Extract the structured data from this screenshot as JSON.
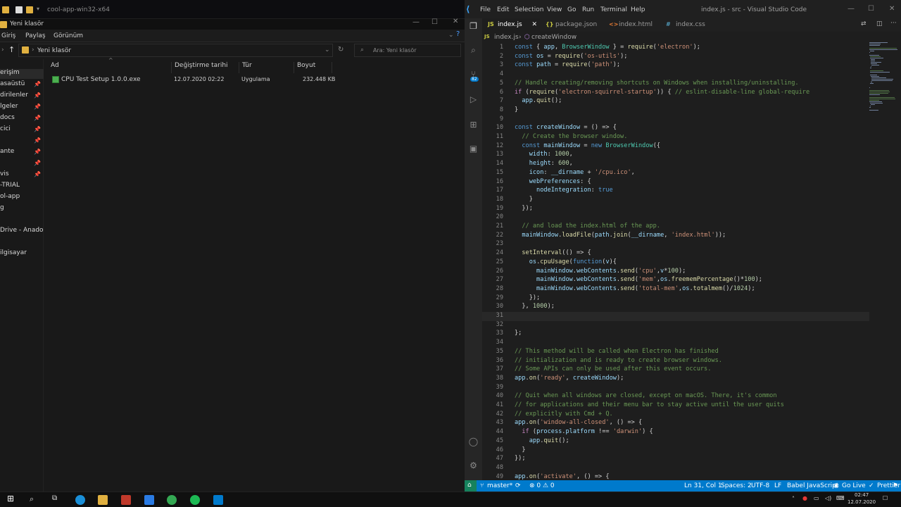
{
  "explorer": {
    "window_title": "cool-app-win32-x64",
    "folder_title": "Yeni klasör",
    "ribbon": [
      "Giriş",
      "Paylaş",
      "Görünüm"
    ],
    "address": "Yeni klasör",
    "search_placeholder": "Ara: Yeni klasör",
    "columns": [
      "Ad",
      "Değiştirme tarihi",
      "Tür",
      "Boyut"
    ],
    "files": [
      {
        "name": "CPU Test Setup 1.0.0.exe",
        "date": "12.07.2020 02:22",
        "type": "Uygulama",
        "size": "232.448 KB"
      }
    ],
    "nav": [
      {
        "label": "erişim",
        "pinned": false
      },
      {
        "label": "asaüstü",
        "pinned": true
      },
      {
        "label": "dirilenler",
        "pinned": true
      },
      {
        "label": "lgeler",
        "pinned": true
      },
      {
        "label": "docs",
        "pinned": true
      },
      {
        "label": "cici",
        "pinned": true
      },
      {
        "label": "",
        "pinned": true
      },
      {
        "label": "ante",
        "pinned": true
      },
      {
        "label": "",
        "pinned": true
      },
      {
        "label": "vis",
        "pinned": true
      },
      {
        "label": "-TRIAL",
        "pinned": false
      },
      {
        "label": "ol-app",
        "pinned": false
      },
      {
        "label": "g",
        "pinned": false
      },
      {
        "label": "",
        "pinned": false
      },
      {
        "label": "Drive - Anadolu Ü",
        "pinned": false
      },
      {
        "label": "",
        "pinned": false
      },
      {
        "label": "ilgisayar",
        "pinned": false
      }
    ]
  },
  "vscode": {
    "menu": [
      "File",
      "Edit",
      "Selection",
      "View",
      "Go",
      "Run",
      "Terminal",
      "Help"
    ],
    "title": "index.js - src - Visual Studio Code",
    "tabs": [
      {
        "label": "index.js",
        "icon": "JS",
        "active": true
      },
      {
        "label": "package.json",
        "icon": "{}",
        "active": false
      },
      {
        "label": "index.html",
        "icon": "<>",
        "active": false
      },
      {
        "label": "index.css",
        "icon": "#",
        "active": false
      }
    ],
    "breadcrumb": [
      "index.js",
      "createWindow"
    ],
    "source_control_badge": "82",
    "code": [
      {
        "n": "1",
        "t": "const { app, BrowserWindow } = require('electron');"
      },
      {
        "n": "2",
        "t": "const os = require('os-utils');"
      },
      {
        "n": "3",
        "t": "const path = require('path');"
      },
      {
        "n": "4",
        "t": ""
      },
      {
        "n": "5",
        "t": "// Handle creating/removing shortcuts on Windows when installing/uninstalling."
      },
      {
        "n": "6",
        "t": "if (require('electron-squirrel-startup')) { // eslint-disable-line global-require"
      },
      {
        "n": "7",
        "t": "  app.quit();"
      },
      {
        "n": "8",
        "t": "}"
      },
      {
        "n": "9",
        "t": ""
      },
      {
        "n": "10",
        "t": "const createWindow = () => {"
      },
      {
        "n": "11",
        "t": "  // Create the browser window."
      },
      {
        "n": "12",
        "t": "  const mainWindow = new BrowserWindow({"
      },
      {
        "n": "13",
        "t": "    width: 1000,"
      },
      {
        "n": "14",
        "t": "    height: 600,"
      },
      {
        "n": "15",
        "t": "    icon: __dirname + '/cpu.ico',"
      },
      {
        "n": "16",
        "t": "    webPreferences: {"
      },
      {
        "n": "17",
        "t": "      nodeIntegration: true"
      },
      {
        "n": "18",
        "t": "    }"
      },
      {
        "n": "19",
        "t": "  });"
      },
      {
        "n": "20",
        "t": ""
      },
      {
        "n": "21",
        "t": "  // and load the index.html of the app."
      },
      {
        "n": "22",
        "t": "  mainWindow.loadFile(path.join(__dirname, 'index.html'));"
      },
      {
        "n": "23",
        "t": ""
      },
      {
        "n": "24",
        "t": "  setInterval(() => {"
      },
      {
        "n": "25",
        "t": "    os.cpuUsage(function(v){"
      },
      {
        "n": "26",
        "t": "      mainWindow.webContents.send('cpu',v*100);"
      },
      {
        "n": "27",
        "t": "      mainWindow.webContents.send('mem',os.freememPercentage()*100);"
      },
      {
        "n": "28",
        "t": "      mainWindow.webContents.send('total-mem',os.totalmem()/1024);"
      },
      {
        "n": "29",
        "t": "    });"
      },
      {
        "n": "30",
        "t": "  }, 1000);"
      },
      {
        "n": "31",
        "t": ""
      },
      {
        "n": "32",
        "t": ""
      },
      {
        "n": "33",
        "t": "};"
      },
      {
        "n": "34",
        "t": ""
      },
      {
        "n": "35",
        "t": "// This method will be called when Electron has finished"
      },
      {
        "n": "36",
        "t": "// initialization and is ready to create browser windows."
      },
      {
        "n": "37",
        "t": "// Some APIs can only be used after this event occurs."
      },
      {
        "n": "38",
        "t": "app.on('ready', createWindow);"
      },
      {
        "n": "39",
        "t": ""
      },
      {
        "n": "40",
        "t": "// Quit when all windows are closed, except on macOS. There, it's common"
      },
      {
        "n": "41",
        "t": "// for applications and their menu bar to stay active until the user quits"
      },
      {
        "n": "42",
        "t": "// explicitly with Cmd + Q."
      },
      {
        "n": "43",
        "t": "app.on('window-all-closed', () => {"
      },
      {
        "n": "44",
        "t": "  if (process.platform !== 'darwin') {"
      },
      {
        "n": "45",
        "t": "    app.quit();"
      },
      {
        "n": "46",
        "t": "  }"
      },
      {
        "n": "47",
        "t": "});"
      },
      {
        "n": "48",
        "t": ""
      },
      {
        "n": "49",
        "t": "app.on('activate', () => {"
      }
    ],
    "status": {
      "branch": "master*",
      "problems": "⊗ 0 ⚠ 0",
      "position": "Ln 31, Col 1",
      "spaces": "Spaces: 2",
      "encoding": "UTF-8",
      "eol": "LF",
      "language": "Babel JavaScript",
      "golive": "Go Live",
      "prettier": "Prettier"
    }
  },
  "taskbar": {
    "time": "02:47",
    "date": "12.07.2020"
  },
  "colors": {
    "status_bar": "#007acc",
    "explorer_bg": "#191919",
    "editor_bg": "#1e1e1e"
  }
}
